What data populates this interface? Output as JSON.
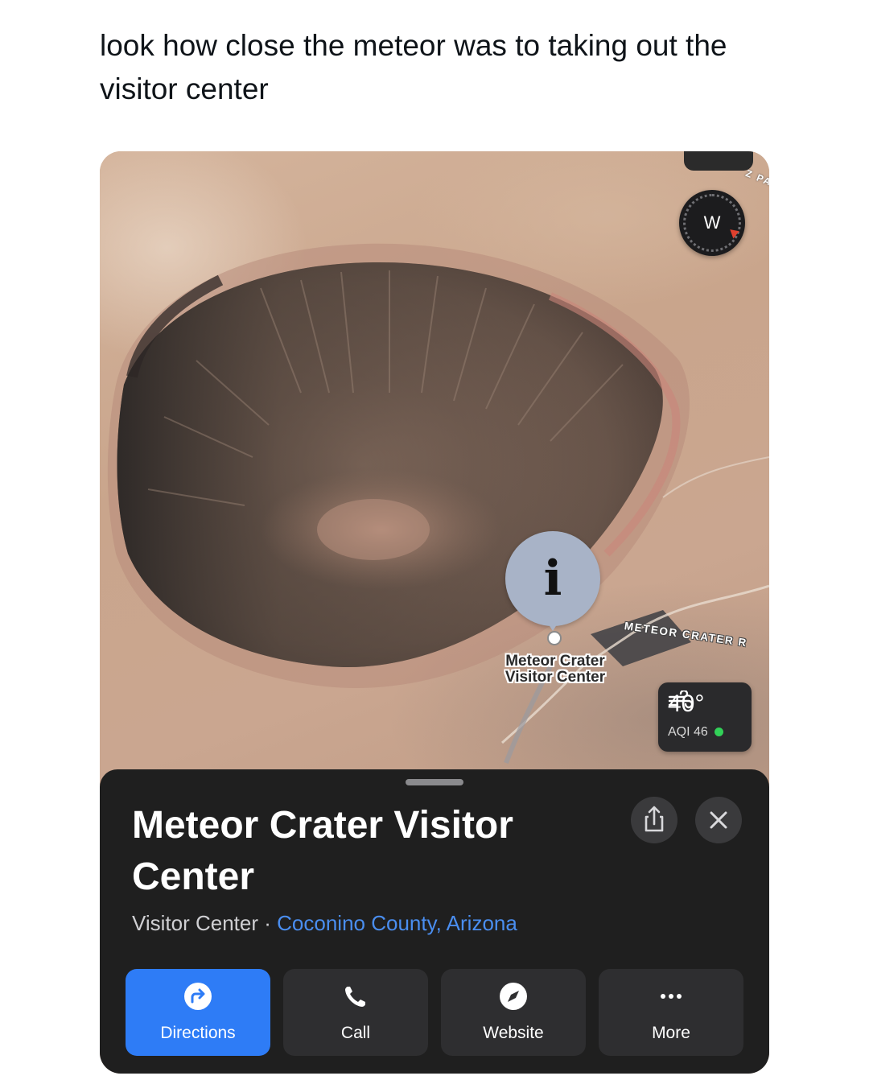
{
  "post": {
    "caption": "look how close the meteor was to taking out the visitor center"
  },
  "map": {
    "road_label_top": "Z PA",
    "compass_letter": "W",
    "road_label_right": "METEOR CRATER R",
    "pin_glyph": "i",
    "place_label_line1": "Meteor Crater",
    "place_label_line2": "Visitor Center",
    "weather": {
      "temperature": "40°",
      "aqi": "AQI 46",
      "aqi_status_color": "#32d158"
    }
  },
  "sheet": {
    "title": "Meteor Crater Visitor Center",
    "category": "Visitor Center · ",
    "location_link": "Coconino County, Arizona",
    "actions": [
      {
        "label": "Directions",
        "icon": "directions-icon"
      },
      {
        "label": "Call",
        "icon": "phone-icon"
      },
      {
        "label": "Website",
        "icon": "compass-icon"
      },
      {
        "label": "More",
        "icon": "ellipsis-icon"
      }
    ]
  },
  "colors": {
    "accent": "#2e7cf6",
    "link": "#4a8ef0",
    "sheet_bg": "#1f1f1f",
    "pin": "#a8b3c7"
  }
}
